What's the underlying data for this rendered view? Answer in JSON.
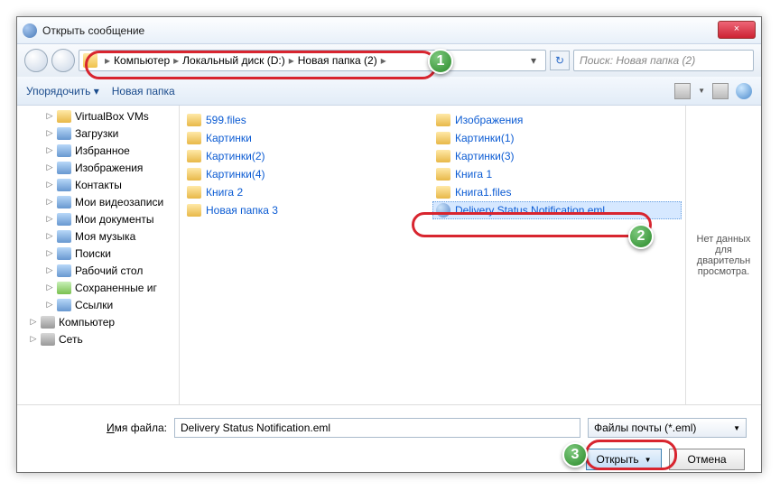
{
  "title": "Открыть сообщение",
  "close": "×",
  "breadcrumb": {
    "root": "Компьютер",
    "drive": "Локальный диск (D:)",
    "folder": "Новая папка (2)",
    "sep": "▸",
    "drop": "▾"
  },
  "refresh": "↻",
  "search": {
    "placeholder": "Поиск: Новая папка (2)"
  },
  "toolbar": {
    "organize": "Упорядочить ▾",
    "newfolder": "Новая папка"
  },
  "sidebar": [
    {
      "label": "VirtualBox VMs",
      "cls": "",
      "icon": ""
    },
    {
      "label": "Загрузки",
      "cls": "",
      "icon": "sp"
    },
    {
      "label": "Избранное",
      "cls": "",
      "icon": "sp"
    },
    {
      "label": "Изображения",
      "cls": "",
      "icon": "sp"
    },
    {
      "label": "Контакты",
      "cls": "",
      "icon": "sp"
    },
    {
      "label": "Мои видеозаписи",
      "cls": "",
      "icon": "sp"
    },
    {
      "label": "Мои документы",
      "cls": "",
      "icon": "sp"
    },
    {
      "label": "Моя музыка",
      "cls": "",
      "icon": "sp"
    },
    {
      "label": "Поиски",
      "cls": "",
      "icon": "sp"
    },
    {
      "label": "Рабочий стол",
      "cls": "",
      "icon": "sp"
    },
    {
      "label": "Сохраненные иг",
      "cls": "",
      "icon": "green"
    },
    {
      "label": "Ссылки",
      "cls": "",
      "icon": "sp"
    },
    {
      "label": "Компьютер",
      "cls": "l0",
      "icon": "comp"
    },
    {
      "label": "Сеть",
      "cls": "l0",
      "icon": "comp"
    }
  ],
  "files_col1": [
    {
      "label": "599.files"
    },
    {
      "label": "Картинки"
    },
    {
      "label": "Картинки(2)"
    },
    {
      "label": "Картинки(4)"
    },
    {
      "label": "Книга 2"
    },
    {
      "label": "Новая папка 3"
    }
  ],
  "files_col2": [
    {
      "label": "Изображения"
    },
    {
      "label": "Картинки(1)"
    },
    {
      "label": "Картинки(3)"
    },
    {
      "label": "Книга 1"
    },
    {
      "label": "Книга1.files"
    }
  ],
  "selected_file": "Delivery Status Notification.eml",
  "preview_text": "Нет данных для дварительн просмотра.",
  "filename": {
    "label_pre": "",
    "label_u": "И",
    "label_post": "мя файла:",
    "value": "Delivery Status Notification.eml"
  },
  "filetype": "Файлы почты (*.eml)",
  "open_btn": "Открыть",
  "cancel_btn": "Отмена",
  "callouts": {
    "c1": "1",
    "c2": "2",
    "c3": "3"
  }
}
